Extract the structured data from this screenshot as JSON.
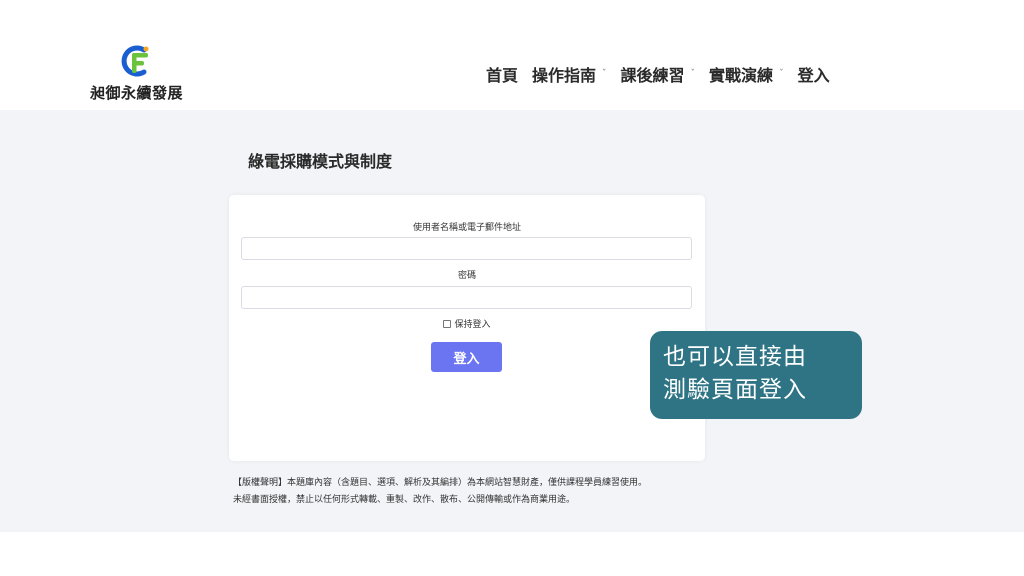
{
  "brand": {
    "name": "昶御永續發展",
    "logo_colors": {
      "blue": "#1a5fd1",
      "green": "#6bc23d",
      "orange": "#f4a51c"
    }
  },
  "nav": {
    "items": [
      {
        "label": "首頁",
        "has_dropdown": false
      },
      {
        "label": "操作指南",
        "has_dropdown": true
      },
      {
        "label": "課後練習",
        "has_dropdown": true
      },
      {
        "label": "實戰演練",
        "has_dropdown": true
      },
      {
        "label": "登入",
        "has_dropdown": false
      }
    ],
    "chevron": "ˇ"
  },
  "page": {
    "title": "綠電採購模式與制度"
  },
  "login_form": {
    "username_label": "使用者名稱或電子郵件地址",
    "username_value": "",
    "password_label": "密碼",
    "password_value": "",
    "remember_label": "保持登入",
    "remember_checked": false,
    "submit_label": "登入",
    "submit_color": "#6b75f2"
  },
  "notice": {
    "line1": "【版權聲明】本題庫內容（含題目、選項、解析及其編排）為本網站智慧財產，僅供課程學員練習使用。",
    "line2": "未經書面授權，禁止以任何形式轉載、重製、改作、散布、公開傳輸或作為商業用途。"
  },
  "annotation": {
    "line1": "也可以直接由",
    "line2": "測驗頁面登入",
    "background": "#2e7485"
  }
}
